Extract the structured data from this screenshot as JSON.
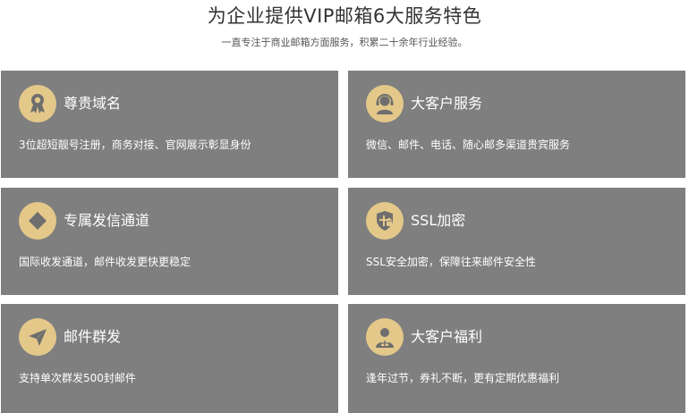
{
  "header": {
    "title": "为企业提供VIP邮箱6大服务特色",
    "subtitle": "一直专注于商业邮箱方面服务，积累二十余年行业经验。"
  },
  "colors": {
    "card_bg": "#7f7f7f",
    "icon_bg": "#e3c88a",
    "icon_fg": "#6e6e6e",
    "text": "#ffffff"
  },
  "features": [
    {
      "icon": "award-medal-icon",
      "title": "尊贵域名",
      "desc": "3位超短靓号注册，商务对接、官网展示彰显身份"
    },
    {
      "icon": "customer-service-headset-icon",
      "title": "大客户服务",
      "desc": "微信、邮件、电话、随心邮多渠道贵宾服务"
    },
    {
      "icon": "diamond-icon",
      "title": "专属发信通道",
      "desc": "国际收发通道，邮件收发更快更稳定"
    },
    {
      "icon": "shield-lock-icon",
      "title": "SSL加密",
      "desc": "SSL安全加密，保障往来邮件安全性"
    },
    {
      "icon": "paper-plane-icon",
      "title": "邮件群发",
      "desc": "支持单次群发500封邮件"
    },
    {
      "icon": "user-gift-icon",
      "title": "大客户福利",
      "desc": "逢年过节，券礼不断，更有定期优惠福利"
    }
  ]
}
